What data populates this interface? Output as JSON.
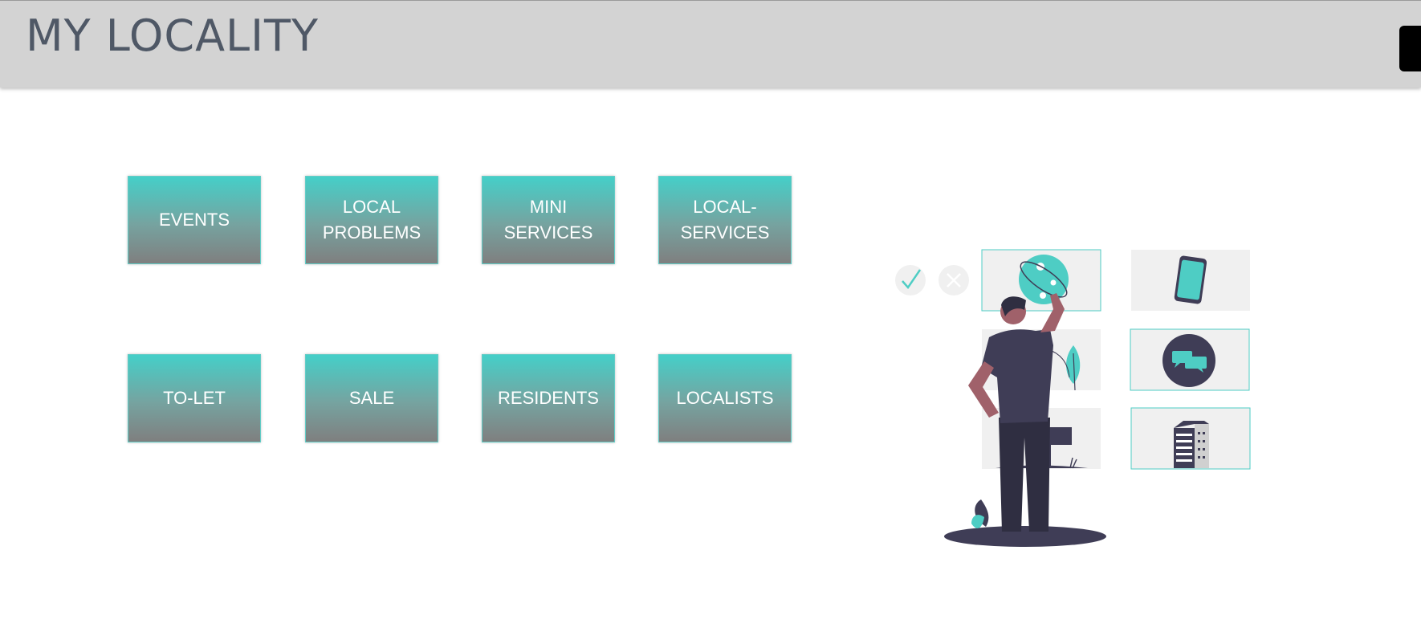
{
  "header": {
    "title": "MY LOCALITY"
  },
  "tiles": [
    {
      "label": "EVENTS"
    },
    {
      "label": "LOCAL\nPROBLEMS"
    },
    {
      "label": "MINI SERVICES"
    },
    {
      "label": "LOCAL-\nSERVICES"
    },
    {
      "label": "TO-LET"
    },
    {
      "label": "SALE"
    },
    {
      "label": "RESIDENTS"
    },
    {
      "label": "LOCALISTS"
    }
  ],
  "colors": {
    "accent": "#4ecdc4",
    "header_bg": "#d3d3d3",
    "title": "#4f5866",
    "tile_top": "#45cfc8",
    "tile_bottom": "#7f7f7f",
    "figure_dark": "#3f3d56"
  },
  "illustration": {
    "icons": [
      "check-icon",
      "close-icon",
      "globe-icon",
      "phone-icon",
      "leaf-icon",
      "chat-icon",
      "sign-icon",
      "building-icon",
      "person-figure"
    ]
  }
}
